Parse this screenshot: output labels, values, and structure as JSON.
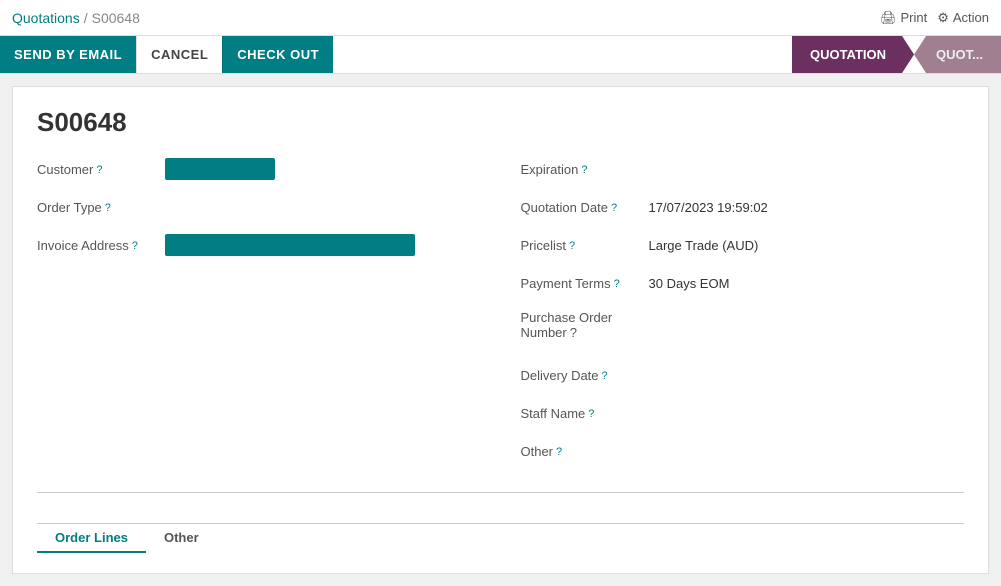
{
  "breadcrumb": {
    "parent": "Quotations",
    "separator": "/",
    "current": "S00648"
  },
  "topbar": {
    "print_label": "Print",
    "action_label": "Action"
  },
  "toolbar": {
    "send_by_email_label": "SEND BY EMAIL",
    "cancel_label": "CANCEL",
    "checkout_label": "CHECK OUT"
  },
  "status_tabs": [
    {
      "label": "QUOTATION",
      "active": true
    },
    {
      "label": "QUOT...",
      "active": false
    }
  ],
  "form": {
    "title": "S00648",
    "left": {
      "customer_label": "Customer",
      "customer_help": "?",
      "order_type_label": "Order Type",
      "order_type_help": "?",
      "invoice_address_label": "Invoice Address",
      "invoice_address_help": "?"
    },
    "right": {
      "expiration_label": "Expiration",
      "expiration_help": "?",
      "expiration_value": "",
      "quotation_date_label": "Quotation Date",
      "quotation_date_help": "?",
      "quotation_date_value": "17/07/2023 19:59:02",
      "pricelist_label": "Pricelist",
      "pricelist_help": "?",
      "pricelist_value": "Large Trade (AUD)",
      "payment_terms_label": "Payment Terms",
      "payment_terms_help": "?",
      "payment_terms_value": "30 Days EOM",
      "purchase_order_label": "Purchase Order",
      "purchase_order_label2": "Number",
      "purchase_order_help": "?",
      "purchase_order_value": "",
      "delivery_date_label": "Delivery Date",
      "delivery_date_help": "?",
      "delivery_date_value": "",
      "staff_name_label": "Staff Name",
      "staff_name_help": "?",
      "staff_name_value": "",
      "other_label": "Other",
      "other_help": "?",
      "other_value": ""
    }
  },
  "bottom_tabs": [
    {
      "label": "Order Lines",
      "active": true
    },
    {
      "label": "Other",
      "active": false
    }
  ]
}
